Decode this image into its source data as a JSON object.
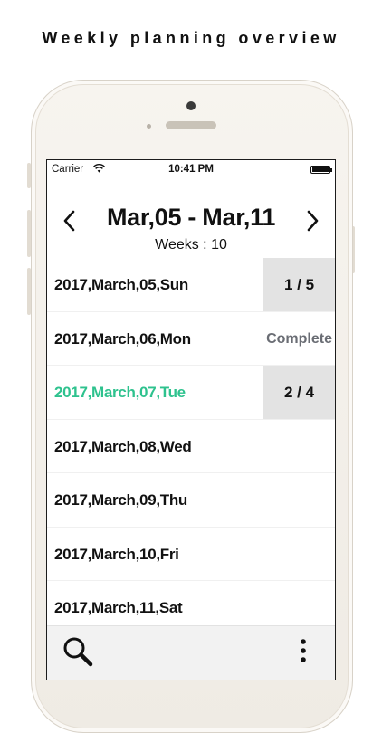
{
  "promo": {
    "headline": "Weekly planning overview"
  },
  "status_bar": {
    "carrier": "Carrier",
    "time": "10:41 PM"
  },
  "header": {
    "range": "Mar,05 - Mar,11",
    "weeks": "Weeks : 10"
  },
  "days": [
    {
      "label": "2017,March,05,Sun",
      "progress": "1 / 5",
      "state": "count"
    },
    {
      "label": "2017,March,06,Mon",
      "progress": "Complete",
      "state": "complete"
    },
    {
      "label": "2017,March,07,Tue",
      "progress": "2 / 4",
      "state": "count",
      "highlight": true
    },
    {
      "label": "2017,March,08,Wed",
      "progress": "",
      "state": "none"
    },
    {
      "label": "2017,March,09,Thu",
      "progress": "",
      "state": "none"
    },
    {
      "label": "2017,March,10,Fri",
      "progress": "",
      "state": "none"
    },
    {
      "label": "2017,March,11,Sat",
      "progress": "",
      "state": "none"
    }
  ],
  "colors": {
    "highlight_text": "#2ec28e",
    "progress_bg": "#e3e3e3",
    "complete_text": "#6a6d74",
    "toolbar_bg": "#f2f2f2"
  },
  "icons": {
    "prev": "chevron-left-icon",
    "next": "chevron-right-icon",
    "search": "search-icon",
    "more": "more-vertical-icon",
    "wifi": "wifi-icon",
    "battery": "battery-icon"
  }
}
